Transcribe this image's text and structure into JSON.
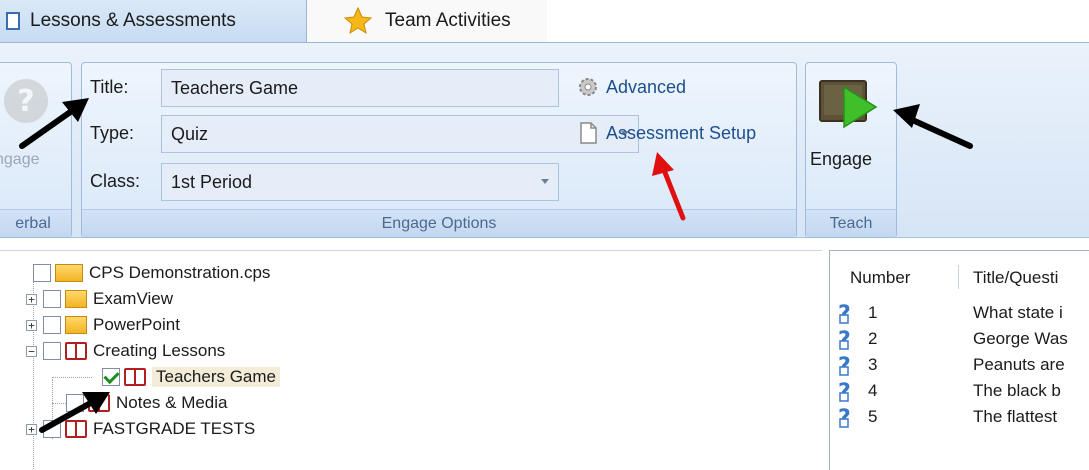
{
  "tabs": [
    {
      "label": "Lessons & Assessments",
      "active": true
    },
    {
      "label": "Team Activities",
      "active": false
    }
  ],
  "ribbon": {
    "verbal_group": {
      "button_label": "ngage",
      "caption": "erbal"
    },
    "engage_options": {
      "caption": "Engage Options",
      "title_label": "Title:",
      "title_value": "Teachers Game",
      "type_label": "Type:",
      "type_value": "Quiz",
      "class_label": "Class:",
      "class_value": "1st Period",
      "advanced_label": "Advanced",
      "assessment_setup_label": "Assessment Setup"
    },
    "teach_group": {
      "button_label": "Engage",
      "caption": "Teach"
    }
  },
  "tree": {
    "root": "CPS Demonstration.cps",
    "items": [
      {
        "label": "ExamView"
      },
      {
        "label": "PowerPoint"
      },
      {
        "label": "Creating Lessons"
      },
      {
        "label": "Teachers Game"
      },
      {
        "label": "Notes & Media"
      },
      {
        "label": "FASTGRADE TESTS"
      }
    ]
  },
  "question_list": {
    "columns": [
      "Number",
      "Title/Questi"
    ],
    "rows": [
      {
        "number": "1",
        "title": "What state i"
      },
      {
        "number": "2",
        "title": "George Was"
      },
      {
        "number": "3",
        "title": "Peanuts are"
      },
      {
        "number": "4",
        "title": "The black b"
      },
      {
        "number": "5",
        "title": "The flattest"
      }
    ]
  },
  "colors": {
    "ribbon_bg": "#d9e8f8",
    "link": "#1d4f8f",
    "annotation_black": "#000000",
    "annotation_red": "#e01010"
  }
}
